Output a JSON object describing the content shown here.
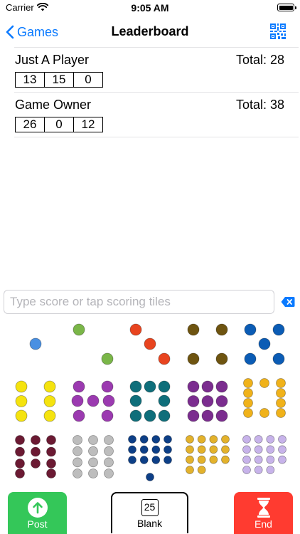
{
  "status_bar": {
    "carrier": "Carrier",
    "time": "9:05 AM"
  },
  "nav": {
    "back_label": "Games",
    "title": "Leaderboard"
  },
  "players": [
    {
      "name": "Just A Player",
      "total": "Total: 28",
      "scores": [
        "13",
        "15",
        "0"
      ]
    },
    {
      "name": "Game Owner",
      "total": "Total: 38",
      "scores": [
        "26",
        "0",
        "12"
      ]
    }
  ],
  "score_input": {
    "value": "",
    "placeholder": "Type score or tap scoring tiles"
  },
  "scoring_tiles": [
    {
      "pips": 1,
      "color": "#4a90e2"
    },
    {
      "pips": 2,
      "color": "#7ab648"
    },
    {
      "pips": 3,
      "color": "#e8441f"
    },
    {
      "pips": 4,
      "color": "#6e5410"
    },
    {
      "pips": 5,
      "color": "#0b5cb5"
    },
    {
      "pips": 6,
      "color": "#f5e30f"
    },
    {
      "pips": 7,
      "color": "#9b3ab0"
    },
    {
      "pips": 8,
      "color": "#0f6e7a"
    },
    {
      "pips": 9,
      "color": "#7b2d8f"
    },
    {
      "pips": 10,
      "color": "#f0b21a"
    },
    {
      "pips": 11,
      "color": "#6b1a33"
    },
    {
      "pips": 12,
      "color": "#bdbdbd"
    },
    {
      "pips": 13,
      "color": "#0d3f87"
    },
    {
      "pips": 14,
      "color": "#e3b22c"
    },
    {
      "pips": 15,
      "color": "#c7b3ea"
    }
  ],
  "bottom_bar": {
    "post_label": "Post",
    "blank_label": "Blank",
    "blank_value": "25",
    "end_label": "End"
  },
  "colors": {
    "accent": "#0a7aff",
    "post_green": "#34c759",
    "end_red": "#ff3b30"
  }
}
